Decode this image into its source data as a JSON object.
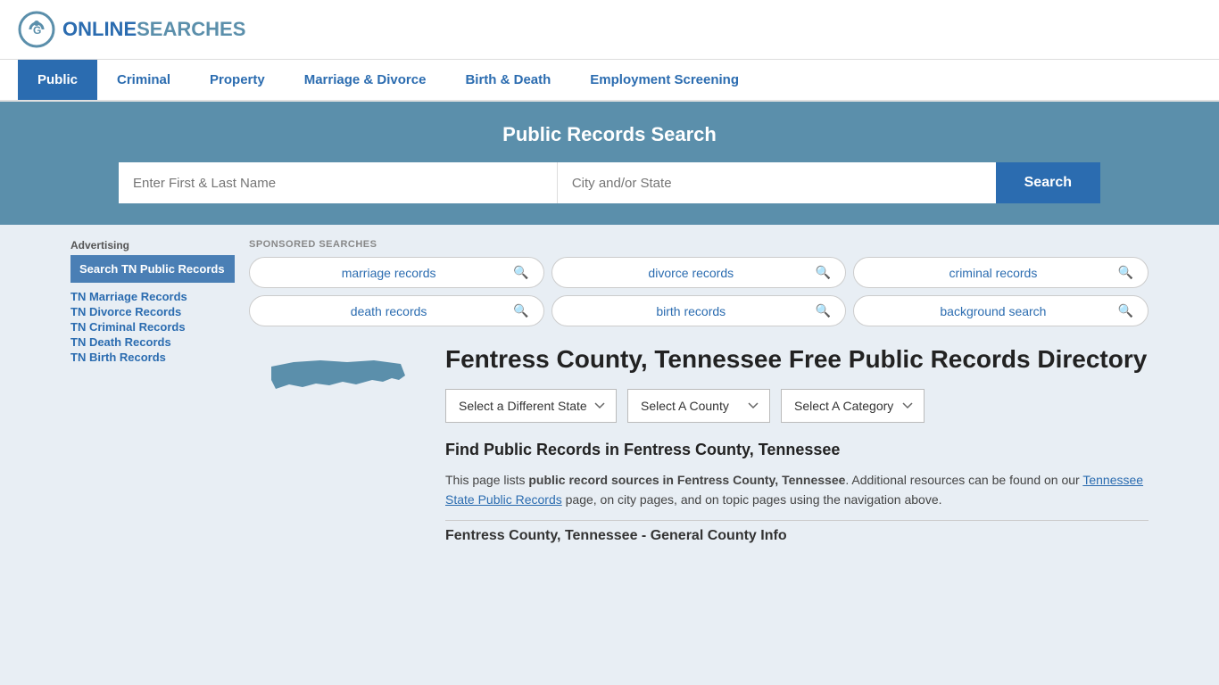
{
  "header": {
    "logo_text_plain": "ONLINE",
    "logo_text_brand": "SEARCHES"
  },
  "nav": {
    "items": [
      {
        "label": "Public",
        "active": true
      },
      {
        "label": "Criminal",
        "active": false
      },
      {
        "label": "Property",
        "active": false
      },
      {
        "label": "Marriage & Divorce",
        "active": false
      },
      {
        "label": "Birth & Death",
        "active": false
      },
      {
        "label": "Employment Screening",
        "active": false
      }
    ]
  },
  "search_banner": {
    "title": "Public Records Search",
    "name_placeholder": "Enter First & Last Name",
    "city_placeholder": "City and/or State",
    "button_label": "Search"
  },
  "sponsored": {
    "label": "SPONSORED SEARCHES",
    "items": [
      {
        "label": "marriage records"
      },
      {
        "label": "divorce records"
      },
      {
        "label": "criminal records"
      },
      {
        "label": "death records"
      },
      {
        "label": "birth records"
      },
      {
        "label": "background search"
      }
    ]
  },
  "sidebar": {
    "advertising_label": "Advertising",
    "ad_box_label": "Search TN Public Records",
    "links": [
      {
        "label": "TN Marriage Records"
      },
      {
        "label": "TN Divorce Records"
      },
      {
        "label": "TN Criminal Records"
      },
      {
        "label": "TN Death Records"
      },
      {
        "label": "TN Birth Records"
      }
    ]
  },
  "county": {
    "title": "Fentress County, Tennessee Free Public Records Directory",
    "dropdowns": {
      "state": "Select a Different State",
      "county": "Select A County",
      "category": "Select A Category"
    },
    "find_heading": "Find Public Records in Fentress County, Tennessee",
    "description_part1": "This page lists ",
    "description_bold1": "public record sources in Fentress County, Tennessee",
    "description_part2": ". Additional resources can be found on our ",
    "description_link": "Tennessee State Public Records",
    "description_part3": " page, on city pages, and on topic pages using the navigation above.",
    "general_info_heading": "Fentress County, Tennessee - General County Info"
  }
}
